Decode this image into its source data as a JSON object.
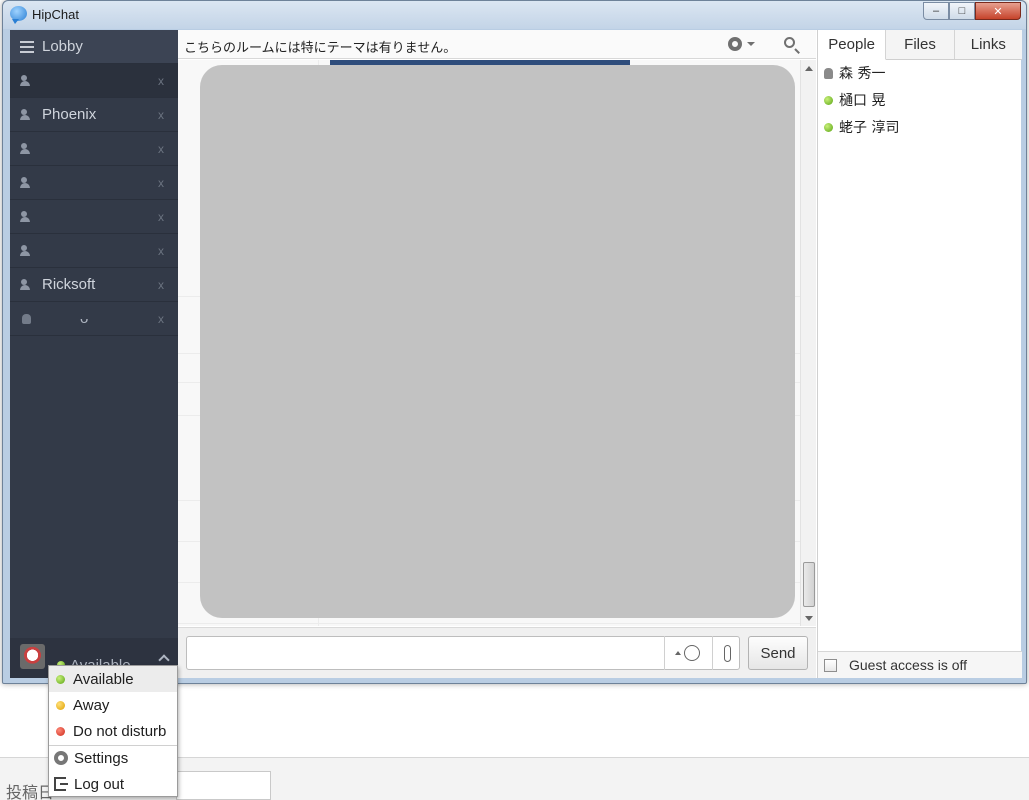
{
  "window": {
    "title": "HipChat",
    "min": "–",
    "max": "□",
    "close": "✕"
  },
  "sidebar": {
    "items": [
      {
        "label": "Lobby",
        "icon": "list-icon"
      },
      {
        "label": "",
        "icon": "people-icon",
        "close": "x"
      },
      {
        "label": "Phoenix",
        "icon": "people-icon",
        "close": "x"
      },
      {
        "label": "",
        "icon": "people-icon",
        "close": "x"
      },
      {
        "label": "",
        "icon": "people-icon",
        "close": "x"
      },
      {
        "label": "",
        "icon": "people-icon",
        "close": "x"
      },
      {
        "label": "",
        "icon": "people-icon",
        "close": "x"
      },
      {
        "label": "Ricksoft",
        "icon": "people-icon",
        "close": "x"
      },
      {
        "label": "ᴗ",
        "icon": "android-icon",
        "close": "x"
      }
    ],
    "status_label": "Available"
  },
  "chat": {
    "topic": "こちらのルームには特にテーマは有りません。",
    "send_label": "Send",
    "input_value": ""
  },
  "right_panel": {
    "tabs": [
      "People",
      "Files",
      "Links"
    ],
    "active_tab": "People",
    "people": [
      {
        "name": "森 秀一",
        "status": "android"
      },
      {
        "name": "樋口 晃",
        "status": "available"
      },
      {
        "name": "蛯子 淳司",
        "status": "available"
      }
    ],
    "guest_access": "Guest access is off"
  },
  "status_menu": {
    "available": "Available",
    "away": "Away",
    "dnd": "Do not disturb",
    "settings": "Settings",
    "logout": "Log out"
  },
  "desktop": {
    "label": "投稿日"
  },
  "colors": {
    "sidebar": "#333a48",
    "available": "#59a414",
    "away": "#e0a000",
    "dnd": "#cc2a1a"
  }
}
